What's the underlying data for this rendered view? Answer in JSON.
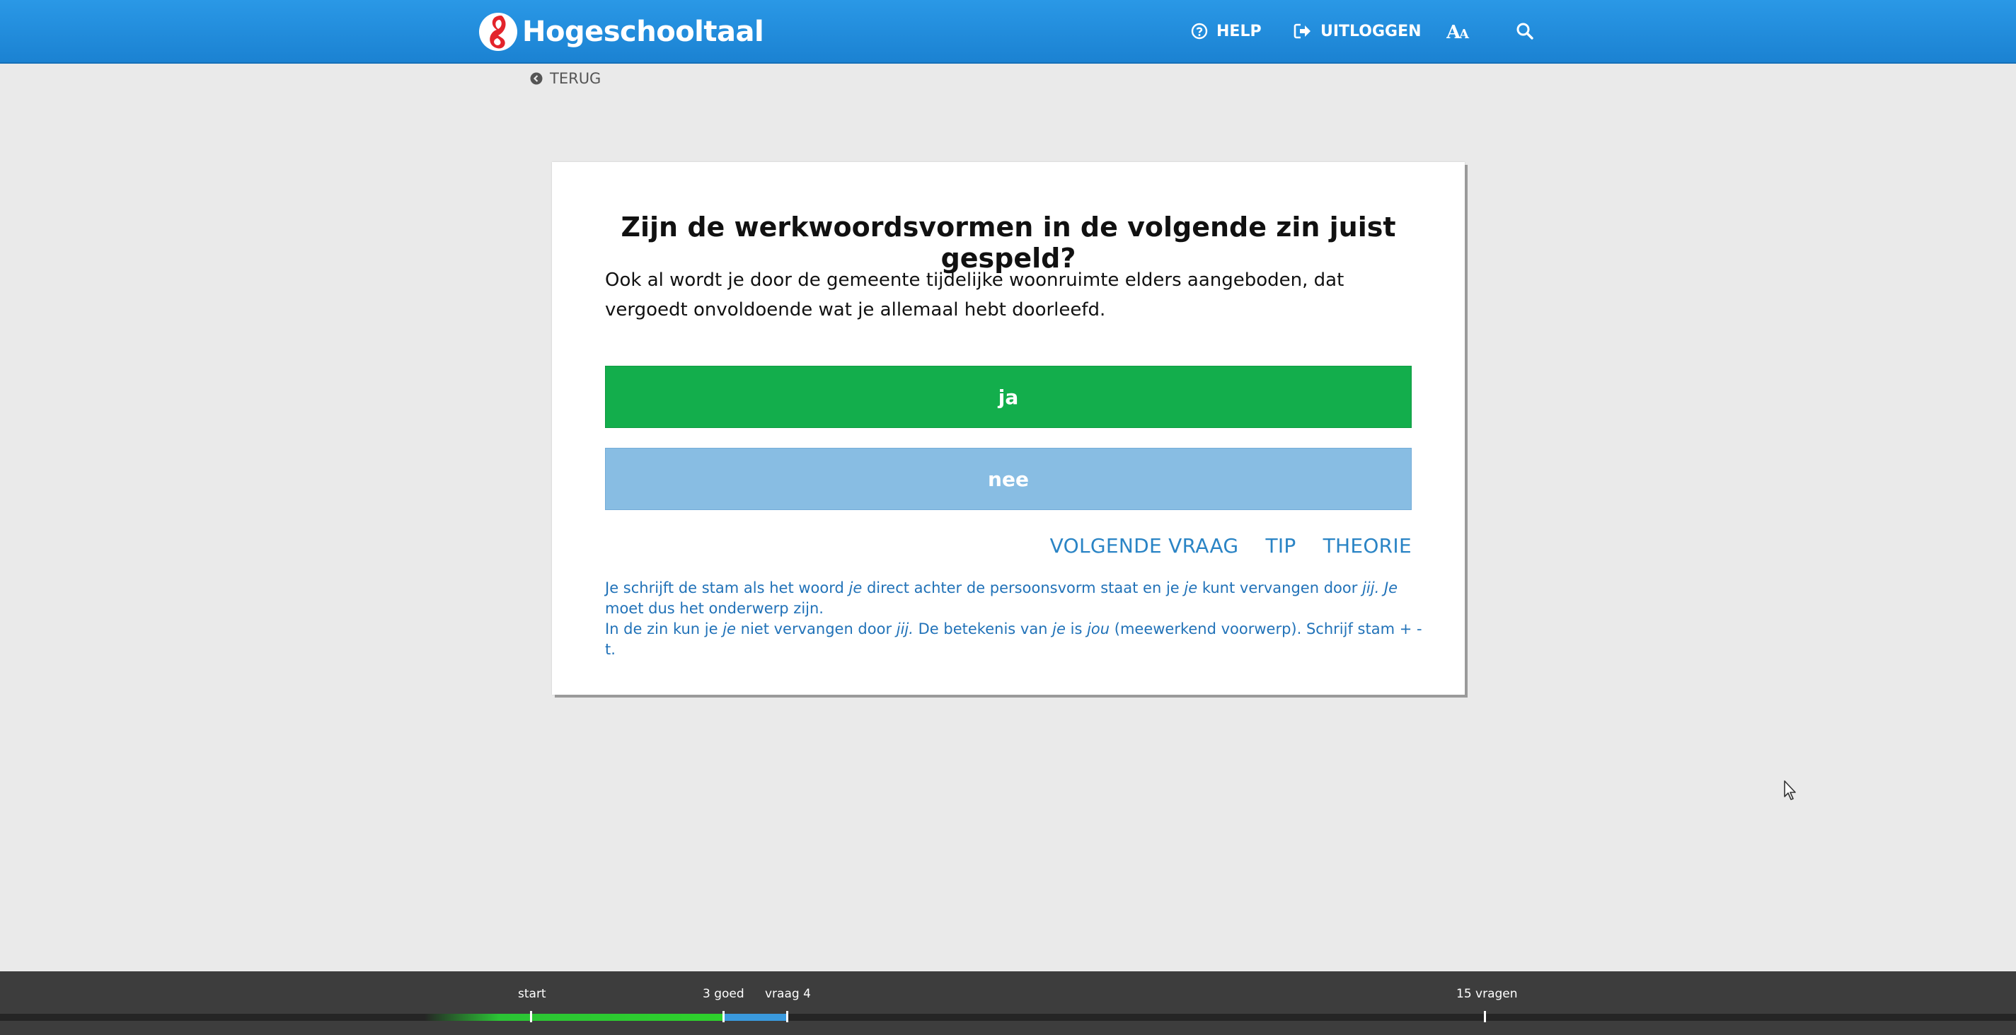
{
  "header": {
    "brand": "Hogeschooltaal",
    "nav": {
      "help_label": "HELP",
      "logout_label": "UITLOGGEN",
      "font_label": "AA"
    }
  },
  "back_label": "TERUG",
  "exercise": {
    "question": "Zijn de werkwoordsvormen in de volgende zin juist gespeld?",
    "sentence": "Ook al wordt je door de gemeente tijdelijke woonruimte elders aangeboden, dat vergoedt onvoldoende wat je allemaal hebt doorleefd.",
    "answers": [
      {
        "label": "ja",
        "state": "correct",
        "color": "#13ae4c"
      },
      {
        "label": "nee",
        "state": "not-selected",
        "color": "#88bde3"
      }
    ],
    "actions": {
      "next": "VOLGENDE VRAAG",
      "tip": "TIP",
      "theory": "THEORIE"
    },
    "feedback": {
      "line1_parts": [
        "Je schrijft de stam als het woord ",
        "je",
        " direct achter de persoonsvorm staat en je ",
        "je",
        " kunt vervangen door ",
        "jij.",
        " ",
        "Je",
        " moet dus het onderwerp zijn."
      ],
      "line2_parts": [
        "In de zin kun je ",
        "je",
        " niet vervangen door ",
        "jij.",
        " De betekenis van ",
        "je",
        " is ",
        "jou",
        " (meewerkend voorwerp). Schrijf stam + -t."
      ]
    }
  },
  "progress": {
    "start_label": "start",
    "correct_label": "3 goed",
    "current_label": "vraag 4",
    "total_label": "15 vragen",
    "correct_count": 3,
    "current_question": 4,
    "total_questions": 15,
    "colors": {
      "correct": "#2ed12c",
      "current": "#3a9ade",
      "track": "#252525"
    }
  },
  "colors": {
    "header": "#1b82d2",
    "link": "#2a84c5",
    "feedback": "#2172b8"
  }
}
